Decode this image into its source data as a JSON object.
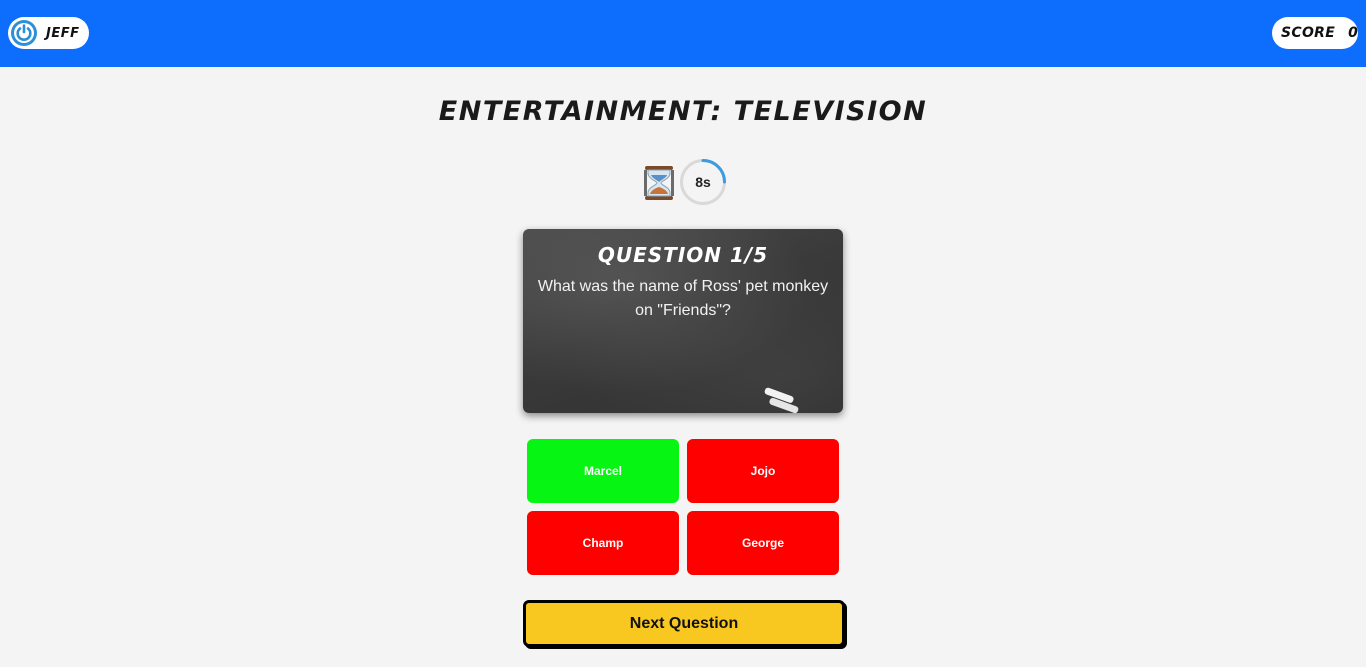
{
  "header": {
    "username": "JEFF",
    "power_icon": "power-icon",
    "score_label": "SCORE",
    "score_value": "0"
  },
  "category": "ENTERTAINMENT: TELEVISION",
  "timer": {
    "icon": "hourglass-icon",
    "text": "8s",
    "remaining_fraction": 0.25,
    "ring_color": "#3d9be0"
  },
  "question": {
    "number_label": "QUESTION 1/5",
    "text": "What was the name of Ross' pet monkey on \"Friends\"?"
  },
  "answers": [
    {
      "label": "Marcel",
      "state": "correct",
      "color": "#06f512"
    },
    {
      "label": "Jojo",
      "state": "wrong",
      "color": "#ff0000"
    },
    {
      "label": "Champ",
      "state": "wrong",
      "color": "#ff0000"
    },
    {
      "label": "George",
      "state": "wrong",
      "color": "#ff0000"
    }
  ],
  "next_button": {
    "label": "Next Question",
    "color": "#f9c820"
  },
  "colors": {
    "topbar": "#0d6efd",
    "background": "#f4f4f4"
  }
}
